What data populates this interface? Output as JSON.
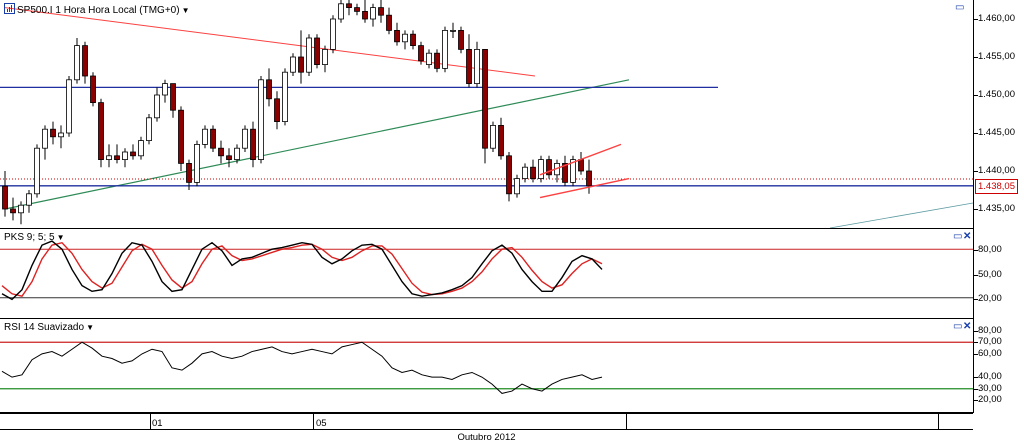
{
  "colors": {
    "up": "#ffffff",
    "down": "#8b0000",
    "trend_red": "#ff4040",
    "trend_green": "#2e8b57",
    "blue_line": "#1f2f9f",
    "dotted_red": "#cc0000",
    "pks_k": "#000000",
    "pks_d": "#dd2222",
    "rsi": "#000000",
    "lvl_red": "#cc2222",
    "lvl_green": "#228b22",
    "lvl_blue": "#2233aa"
  },
  "price_pane": {
    "title": "SP500.I 1 Hora Hora Local (TMG+0)",
    "icon": "chart-icon",
    "last_value_label": "1.438,05",
    "ticks": [
      "1.460,00",
      "1.455,00",
      "1.450,00",
      "1.445,00",
      "1.440,00",
      "1.435,00"
    ]
  },
  "pks_pane": {
    "title": "PKS 9; 5; 5",
    "ticks": [
      "80,00",
      "50,00",
      "20,00"
    ],
    "levels": [
      80,
      20
    ]
  },
  "rsi_pane": {
    "title": "RSI 14 Suavizado",
    "ticks": [
      "80,00",
      "70,00",
      "60,00",
      "40,00",
      "30,00",
      "20,00"
    ],
    "levels": [
      70,
      30
    ]
  },
  "time_axis": {
    "labels": [
      "01",
      "05"
    ],
    "month": "Outubro 2012"
  },
  "chart_data": [
    {
      "type": "candlestick",
      "title": "SP500.I 1 Hora Hora Local (TMG+0)",
      "ylim": [
        1432.5,
        1462.5
      ],
      "horizontal_lines": [
        1451.0,
        1438.05,
        1438.95
      ],
      "last_value": 1438.05,
      "candles": [
        [
          1438.0,
          1440.0,
          1434.0,
          1435.0
        ],
        [
          1435.0,
          1436.5,
          1433.5,
          1434.5
        ],
        [
          1434.5,
          1436.0,
          1433.0,
          1435.5
        ],
        [
          1435.5,
          1437.5,
          1434.5,
          1437.0
        ],
        [
          1437.0,
          1443.5,
          1436.5,
          1443.0
        ],
        [
          1443.0,
          1446.0,
          1441.5,
          1445.5
        ],
        [
          1445.5,
          1446.5,
          1443.5,
          1444.5
        ],
        [
          1444.5,
          1446.0,
          1443.0,
          1445.0
        ],
        [
          1445.0,
          1452.5,
          1444.5,
          1452.0
        ],
        [
          1452.0,
          1457.5,
          1451.5,
          1456.5
        ],
        [
          1456.5,
          1457.0,
          1451.5,
          1452.5
        ],
        [
          1452.5,
          1453.0,
          1448.5,
          1449.0
        ],
        [
          1449.0,
          1449.5,
          1440.5,
          1441.5
        ],
        [
          1441.5,
          1443.5,
          1440.5,
          1442.0
        ],
        [
          1442.0,
          1443.5,
          1441.0,
          1441.5
        ],
        [
          1441.5,
          1443.0,
          1440.5,
          1442.5
        ],
        [
          1442.5,
          1443.5,
          1441.5,
          1442.0
        ],
        [
          1442.0,
          1444.5,
          1441.5,
          1444.0
        ],
        [
          1444.0,
          1447.5,
          1443.5,
          1447.0
        ],
        [
          1447.0,
          1451.0,
          1446.5,
          1450.0
        ],
        [
          1450.0,
          1452.0,
          1449.0,
          1451.5
        ],
        [
          1451.5,
          1451.5,
          1447.0,
          1448.0
        ],
        [
          1448.0,
          1448.5,
          1440.0,
          1441.0
        ],
        [
          1441.0,
          1441.5,
          1437.5,
          1438.5
        ],
        [
          1438.5,
          1444.0,
          1438.0,
          1443.5
        ],
        [
          1443.5,
          1446.0,
          1443.0,
          1445.5
        ],
        [
          1445.5,
          1446.0,
          1442.5,
          1443.0
        ],
        [
          1443.0,
          1444.0,
          1441.0,
          1442.0
        ],
        [
          1442.0,
          1443.0,
          1440.5,
          1441.5
        ],
        [
          1441.5,
          1443.5,
          1441.0,
          1443.0
        ],
        [
          1443.0,
          1446.0,
          1442.5,
          1445.5
        ],
        [
          1445.5,
          1446.5,
          1440.5,
          1441.5
        ],
        [
          1441.5,
          1452.5,
          1441.0,
          1452.0
        ],
        [
          1452.0,
          1453.5,
          1448.5,
          1449.5
        ],
        [
          1449.5,
          1450.5,
          1445.5,
          1446.5
        ],
        [
          1446.5,
          1453.5,
          1446.0,
          1453.0
        ],
        [
          1453.0,
          1455.5,
          1452.5,
          1455.0
        ],
        [
          1455.0,
          1458.5,
          1451.5,
          1453.0
        ],
        [
          1453.0,
          1458.0,
          1452.5,
          1457.5
        ],
        [
          1457.5,
          1458.0,
          1453.5,
          1454.0
        ],
        [
          1454.0,
          1456.5,
          1453.0,
          1456.0
        ],
        [
          1456.0,
          1460.5,
          1455.5,
          1460.0
        ],
        [
          1460.0,
          1462.5,
          1459.5,
          1462.0
        ],
        [
          1462.0,
          1462.5,
          1460.5,
          1461.5
        ],
        [
          1461.5,
          1462.0,
          1460.5,
          1461.0
        ],
        [
          1461.0,
          1462.5,
          1459.5,
          1460.0
        ],
        [
          1460.0,
          1462.0,
          1459.0,
          1461.5
        ],
        [
          1461.5,
          1462.5,
          1459.5,
          1460.5
        ],
        [
          1460.5,
          1461.5,
          1458.0,
          1458.5
        ],
        [
          1458.5,
          1459.5,
          1456.5,
          1457.0
        ],
        [
          1457.0,
          1458.5,
          1456.0,
          1458.0
        ],
        [
          1458.0,
          1458.5,
          1456.0,
          1456.5
        ],
        [
          1456.5,
          1457.0,
          1454.0,
          1454.5
        ],
        [
          1454.0,
          1456.0,
          1453.5,
          1455.5
        ],
        [
          1455.5,
          1456.0,
          1453.0,
          1453.5
        ],
        [
          1453.5,
          1459.0,
          1453.0,
          1458.5
        ],
        [
          1458.5,
          1459.5,
          1457.5,
          1458.5
        ],
        [
          1458.5,
          1459.0,
          1455.5,
          1456.0
        ],
        [
          1456.0,
          1458.0,
          1451.0,
          1451.5
        ],
        [
          1451.5,
          1457.0,
          1451.0,
          1456.0
        ],
        [
          1456.0,
          1454.0,
          1441.0,
          1443.0
        ],
        [
          1443.0,
          1446.5,
          1442.5,
          1446.0
        ],
        [
          1446.0,
          1447.0,
          1441.5,
          1442.0
        ],
        [
          1442.0,
          1442.5,
          1436.0,
          1437.0
        ],
        [
          1437.0,
          1439.5,
          1436.5,
          1439.0
        ],
        [
          1439.0,
          1441.0,
          1438.5,
          1440.5
        ],
        [
          1440.5,
          1441.5,
          1438.5,
          1439.0
        ],
        [
          1439.0,
          1442.0,
          1438.5,
          1441.5
        ],
        [
          1441.5,
          1442.0,
          1439.0,
          1439.5
        ],
        [
          1439.5,
          1441.5,
          1438.5,
          1441.0
        ],
        [
          1441.0,
          1442.0,
          1438.0,
          1438.5
        ],
        [
          1438.5,
          1442.0,
          1438.0,
          1441.5
        ],
        [
          1441.5,
          1442.5,
          1439.5,
          1440.0
        ],
        [
          1440.0,
          1441.5,
          1437.0,
          1438.05
        ]
      ],
      "trendlines": [
        {
          "color": "red",
          "from": [
            0,
            1461.5
          ],
          "to": [
            62,
            1452.5
          ]
        },
        {
          "color": "green",
          "from": [
            0,
            1435.0
          ],
          "to": [
            78,
            1452.0
          ]
        },
        {
          "color": "red",
          "from": [
            62,
            1439.5
          ],
          "to": [
            72,
            1443.5
          ]
        },
        {
          "color": "red",
          "from": [
            62,
            1436.5
          ],
          "to": [
            73,
            1439.0
          ]
        }
      ]
    },
    {
      "type": "line",
      "title": "PKS 9; 5; 5",
      "ylim": [
        0,
        100
      ],
      "levels": [
        80,
        20
      ],
      "series": [
        {
          "values": [
            25,
            18,
            30,
            60,
            85,
            90,
            80,
            55,
            35,
            28,
            30,
            50,
            75,
            88,
            85,
            65,
            40,
            28,
            30,
            55,
            80,
            88,
            78,
            60,
            68,
            70,
            75,
            80,
            82,
            85,
            88,
            86,
            70,
            62,
            68,
            78,
            85,
            86,
            80,
            60,
            40,
            25,
            22,
            24,
            26,
            30,
            35,
            45,
            62,
            78,
            85,
            75,
            55,
            40,
            28,
            28,
            45,
            65,
            72,
            68,
            55
          ]
        },
        {
          "values": [
            35,
            25,
            22,
            40,
            68,
            85,
            88,
            75,
            55,
            40,
            32,
            38,
            58,
            78,
            86,
            80,
            60,
            42,
            32,
            40,
            62,
            80,
            84,
            72,
            66,
            68,
            72,
            76,
            80,
            82,
            85,
            86,
            80,
            70,
            66,
            70,
            78,
            84,
            84,
            74,
            56,
            38,
            27,
            24,
            25,
            28,
            32,
            40,
            52,
            68,
            80,
            82,
            70,
            54,
            40,
            32,
            36,
            50,
            62,
            68,
            62
          ]
        }
      ]
    },
    {
      "type": "line",
      "title": "RSI 14 Suavizado",
      "ylim": [
        10,
        90
      ],
      "levels": [
        70,
        30
      ],
      "series": [
        {
          "values": [
            45,
            40,
            42,
            55,
            60,
            62,
            58,
            64,
            70,
            65,
            58,
            56,
            52,
            54,
            60,
            64,
            62,
            48,
            46,
            52,
            60,
            62,
            58,
            56,
            58,
            62,
            64,
            66,
            62,
            60,
            62,
            64,
            62,
            60,
            66,
            68,
            70,
            64,
            58,
            48,
            44,
            46,
            42,
            40,
            40,
            38,
            42,
            44,
            40,
            34,
            26,
            28,
            34,
            30,
            28,
            34,
            38,
            40,
            42,
            38,
            40
          ]
        }
      ]
    }
  ]
}
